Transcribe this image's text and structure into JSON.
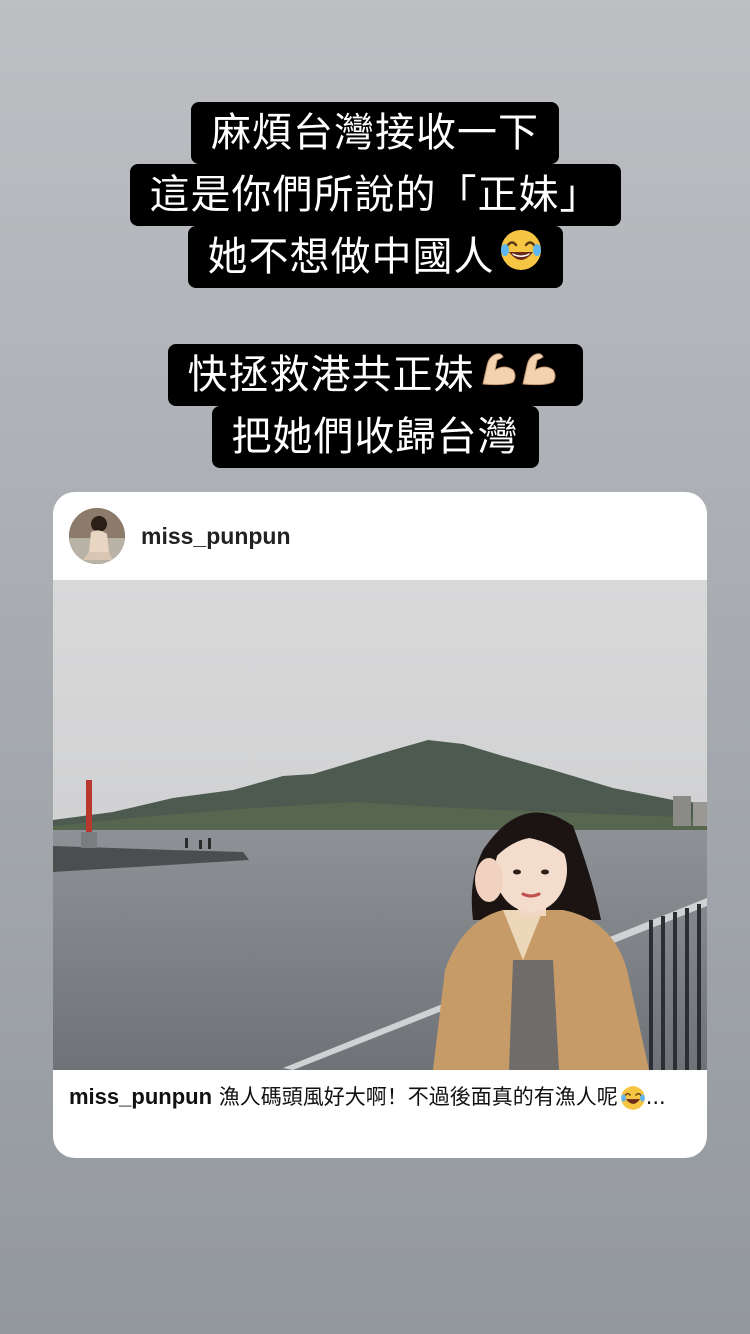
{
  "story": {
    "text_block_1": [
      "麻煩台灣接收一下",
      "這是你們所說的「正妹」",
      "她不想做中國人"
    ],
    "text_block_2": [
      "快拯救港共正妹",
      "把她們收歸台灣"
    ],
    "emojis": {
      "laughing": "laughing-tears-emoji",
      "flexed_biceps": "flexed-biceps-emoji"
    }
  },
  "post": {
    "username": "miss_punpun",
    "caption_user": "miss_punpun",
    "caption_text": " 漁人碼頭風好大啊！不過後面真的有漁人呢",
    "caption_suffix": "..."
  },
  "colors": {
    "caption_background": "#000000",
    "caption_text": "#ffffff",
    "card_background": "#ffffff"
  }
}
